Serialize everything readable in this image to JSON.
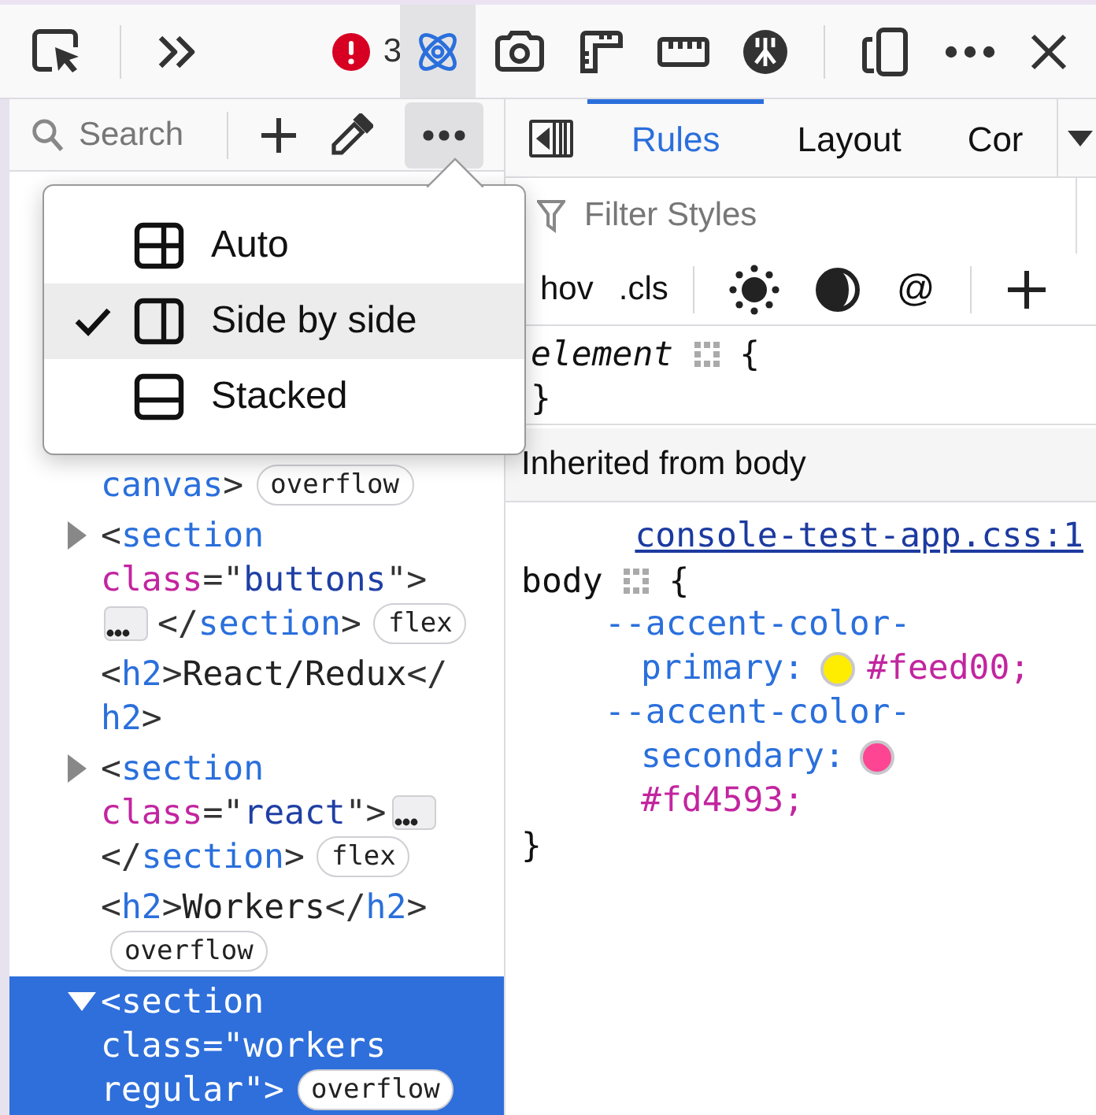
{
  "toolbar": {
    "error_count": "3",
    "panel_tools": [
      {
        "selected": true
      },
      {
        "selected": false
      },
      {
        "selected": false
      },
      {
        "selected": false
      },
      {
        "selected": false
      }
    ]
  },
  "markup_toolbar": {
    "search": {
      "placeholder": "Search"
    },
    "more_pressed": true
  },
  "layout_menu": {
    "items": [
      {
        "label": "Auto",
        "selected": false
      },
      {
        "label": "Side by side",
        "selected": true
      },
      {
        "label": "Stacked",
        "selected": false
      }
    ]
  },
  "markup_tree": [
    {
      "kind": "leaf",
      "selected": false,
      "lines": [
        [
          {
            "kind": "tag",
            "text": "canvas"
          },
          {
            "kind": "punct",
            "text": ">"
          },
          {
            "kind": "badge",
            "text": "overflow"
          }
        ]
      ]
    },
    {
      "kind": "expandable",
      "expanded": false,
      "selected": false,
      "lines": [
        [
          {
            "kind": "punct",
            "text": "<"
          },
          {
            "kind": "tag",
            "text": "section"
          }
        ],
        [
          {
            "kind": "attr",
            "text": "class"
          },
          {
            "kind": "punct",
            "text": "=\""
          },
          {
            "kind": "value",
            "text": "buttons"
          },
          {
            "kind": "punct",
            "text": "\">"
          }
        ],
        [
          {
            "kind": "collapsed"
          },
          {
            "kind": "punct",
            "text": "</"
          },
          {
            "kind": "tag",
            "text": "section"
          },
          {
            "kind": "punct",
            "text": ">"
          },
          {
            "kind": "badge",
            "text": "flex"
          }
        ]
      ]
    },
    {
      "kind": "leaf",
      "selected": false,
      "lines": [
        [
          {
            "kind": "punct",
            "text": "<"
          },
          {
            "kind": "tag",
            "text": "h2"
          },
          {
            "kind": "punct",
            "text": ">"
          },
          {
            "kind": "text",
            "text": "React/Redux"
          },
          {
            "kind": "punct",
            "text": "</"
          }
        ],
        [
          {
            "kind": "tag",
            "text": "h2"
          },
          {
            "kind": "punct",
            "text": ">"
          }
        ]
      ]
    },
    {
      "kind": "expandable",
      "expanded": false,
      "selected": false,
      "lines": [
        [
          {
            "kind": "punct",
            "text": "<"
          },
          {
            "kind": "tag",
            "text": "section"
          }
        ],
        [
          {
            "kind": "attr",
            "text": "class"
          },
          {
            "kind": "punct",
            "text": "=\""
          },
          {
            "kind": "value",
            "text": "react"
          },
          {
            "kind": "punct",
            "text": "\">"
          },
          {
            "kind": "collapsed"
          }
        ],
        [
          {
            "kind": "punct",
            "text": "</"
          },
          {
            "kind": "tag",
            "text": "section"
          },
          {
            "kind": "punct",
            "text": ">"
          },
          {
            "kind": "badge",
            "text": "flex"
          }
        ]
      ]
    },
    {
      "kind": "leaf",
      "selected": false,
      "lines": [
        [
          {
            "kind": "punct",
            "text": "<"
          },
          {
            "kind": "tag",
            "text": "h2"
          },
          {
            "kind": "punct",
            "text": ">"
          },
          {
            "kind": "text",
            "text": "Workers"
          },
          {
            "kind": "punct",
            "text": "</"
          },
          {
            "kind": "tag",
            "text": "h2"
          },
          {
            "kind": "punct",
            "text": ">"
          }
        ],
        [
          {
            "kind": "badge",
            "text": "overflow"
          }
        ]
      ]
    },
    {
      "kind": "expandable",
      "expanded": true,
      "selected": true,
      "lines": [
        [
          {
            "kind": "punct",
            "text": "<"
          },
          {
            "kind": "tag",
            "text": "section"
          }
        ],
        [
          {
            "kind": "attr",
            "text": "class"
          },
          {
            "kind": "punct",
            "text": "=\""
          },
          {
            "kind": "value",
            "text": "workers"
          }
        ],
        [
          {
            "kind": "value",
            "text": "regular"
          },
          {
            "kind": "punct",
            "text": "\">"
          },
          {
            "kind": "badge",
            "text": "overflow"
          }
        ]
      ]
    }
  ],
  "sidebar": {
    "tabs": [
      {
        "label": "Rules",
        "selected": true
      },
      {
        "label": "Layout",
        "selected": false
      },
      {
        "label": "Cor",
        "selected": false
      }
    ],
    "filter": {
      "placeholder": "Filter Styles"
    },
    "rule_tools": {
      "pseudo": "hov",
      "classes": ".cls",
      "at_rules": "@"
    },
    "element_rule": {
      "selector": "element",
      "open": "{",
      "close": "}"
    },
    "inherited": {
      "header": "Inherited from body",
      "source": "console-test-app.css:1",
      "selector": "body",
      "open": "{",
      "close": "}",
      "declarations": [
        {
          "name_lines": [
            "--accent-color-",
            "primary:"
          ],
          "value": "#feed00;",
          "color": "#feed00"
        },
        {
          "name_lines": [
            "--accent-color-",
            "secondary:"
          ],
          "value": "#fd4593;",
          "color": "#fd4593"
        }
      ]
    }
  }
}
